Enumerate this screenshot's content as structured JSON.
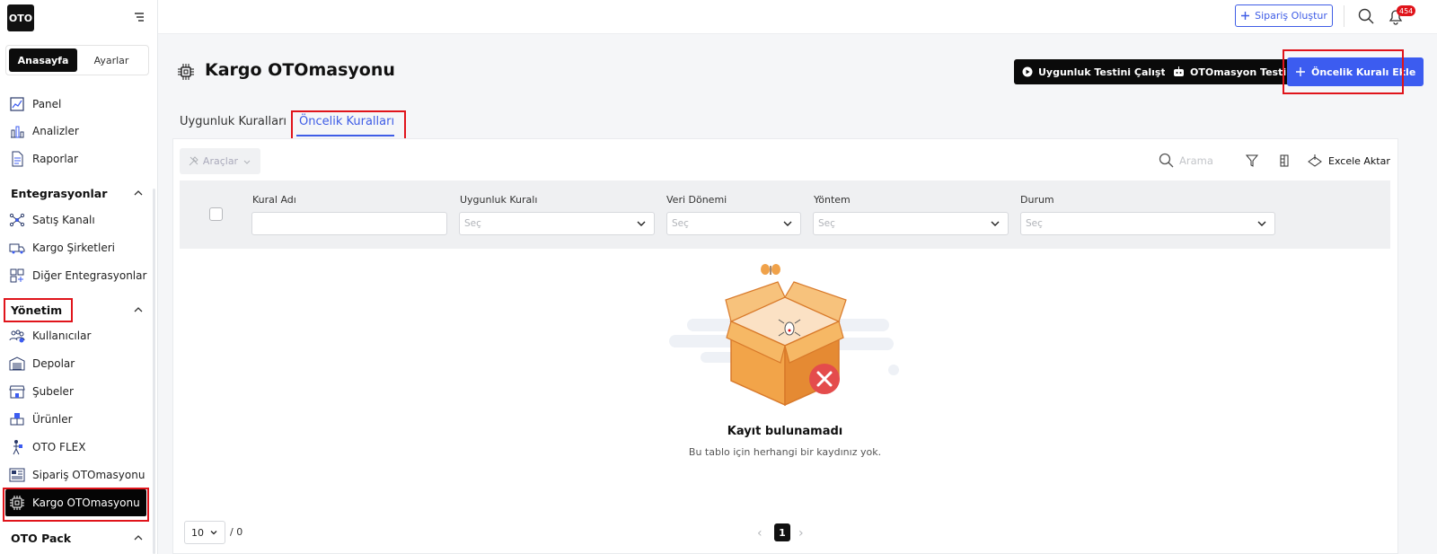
{
  "brand": {
    "logo": "OTO"
  },
  "sidebar": {
    "segments": [
      "Anasayfa",
      "Ayarlar"
    ],
    "items_top": [
      {
        "label": "Panel",
        "icon": "panel-icon"
      },
      {
        "label": "Analizler",
        "icon": "chart-icon"
      },
      {
        "label": "Raporlar",
        "icon": "document-icon"
      }
    ],
    "sections": [
      {
        "title": "Entegrasyonlar",
        "items": [
          {
            "label": "Satış Kanalı",
            "icon": "network-icon"
          },
          {
            "label": "Kargo Şirketleri",
            "icon": "truck-icon"
          },
          {
            "label": "Diğer Entegrasyonlar",
            "icon": "grid-plus-icon"
          }
        ]
      },
      {
        "title": "Yönetim",
        "items": [
          {
            "label": "Kullanıcılar",
            "icon": "users-icon"
          },
          {
            "label": "Depolar",
            "icon": "warehouse-icon"
          },
          {
            "label": "Şubeler",
            "icon": "store-icon"
          },
          {
            "label": "Ürünler",
            "icon": "boxes-icon"
          },
          {
            "label": "OTO FLEX",
            "icon": "courier-icon"
          },
          {
            "label": "Sipariş OTOmasyonu",
            "icon": "order-automation-icon"
          },
          {
            "label": "Kargo OTOmasyonu",
            "icon": "chip-icon"
          }
        ]
      },
      {
        "title": "OTO Pack",
        "items": []
      }
    ]
  },
  "topbar": {
    "create_order": "Sipariş Oluştur",
    "notification_count": "454"
  },
  "page": {
    "title": "Kargo OTOmasyonu",
    "buttons": {
      "run_test": "Uygunluk Testini Çalıştır",
      "automation_test": "OTOmasyon Testi",
      "add_rule": "Öncelik Kuralı Ekle"
    },
    "tabs": [
      "Uygunluk Kuralları",
      "Öncelik Kuralları"
    ]
  },
  "table": {
    "tools": "Araçlar",
    "search_placeholder": "Arama",
    "export": "Excele Aktar",
    "columns": [
      "Kural Adı",
      "Uygunluk Kuralı",
      "Veri Dönemi",
      "Yöntem",
      "Durum"
    ],
    "select_placeholder": "Seç",
    "empty_title": "Kayıt bulunamadı",
    "empty_subtitle": "Bu tablo için herhangi bir kaydınız yok."
  },
  "pagination": {
    "page_size": "10",
    "total": "/ 0",
    "current_page": "1"
  },
  "colors": {
    "accent": "#3c5cf0",
    "highlight": "#e0141b",
    "dark": "#0a0a0a"
  }
}
